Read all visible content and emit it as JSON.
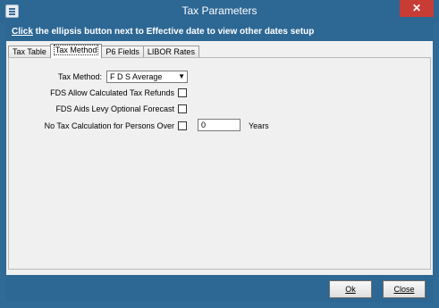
{
  "window": {
    "title": "Tax Parameters",
    "close_glyph": "✕"
  },
  "banner": {
    "click_word": "Click",
    "rest": " the ellipsis button next to Effective date to view other dates setup"
  },
  "tabs": [
    {
      "label": "Tax Table",
      "active": false
    },
    {
      "label": "Tax Method",
      "active": true
    },
    {
      "label": "P6 Fields",
      "active": false
    },
    {
      "label": "LIBOR Rates",
      "active": false
    }
  ],
  "form": {
    "tax_method_label": "Tax Method:",
    "tax_method_value": "F D S Average",
    "refunds_label": "FDS Allow Calculated Tax Refunds",
    "refunds_checked": false,
    "levy_label": "FDS Aids Levy Optional Forecast",
    "levy_checked": false,
    "no_tax_label": "No Tax Calculation for Persons Over",
    "no_tax_checked": false,
    "years_value": "0",
    "years_label": "Years"
  },
  "buttons": {
    "ok_label": "Ok",
    "close_label": "Close"
  }
}
